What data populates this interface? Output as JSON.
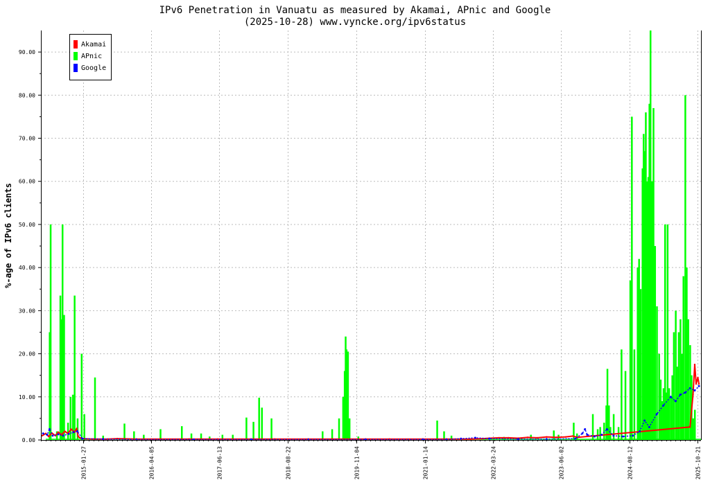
{
  "chart_data": {
    "type": "line",
    "title": "IPv6 Penetration in Vanuatu as measured by Akamai, APnic and Google",
    "subtitle": "(2025-10-28) www.vyncke.org/ipv6status",
    "ylabel": "%-age of IPv6 clients",
    "xlabel": "",
    "ylim": [
      0,
      95
    ],
    "xlim": [
      "2014-05-01",
      "2025-11-10"
    ],
    "yticks": [
      "0.00",
      "10.00",
      "20.00",
      "30.00",
      "40.00",
      "50.00",
      "60.00",
      "70.00",
      "80.00",
      "90.00"
    ],
    "xticks": [
      "2015-01-27",
      "2016-04-05",
      "2017-06-13",
      "2018-08-22",
      "2019-11-04",
      "2021-01-14",
      "2022-03-24",
      "2023-06-02",
      "2024-08-12",
      "2025-10-21"
    ],
    "grid": true,
    "legend_position": "top-left",
    "series": [
      {
        "name": "Akamai",
        "color": "#ff0000",
        "style": "line",
        "points": [
          [
            "2014-05-10",
            1.0
          ],
          [
            "2014-06-01",
            1.5
          ],
          [
            "2014-06-20",
            0.8
          ],
          [
            "2014-07-10",
            1.6
          ],
          [
            "2014-08-01",
            1.0
          ],
          [
            "2014-08-20",
            1.8
          ],
          [
            "2014-09-10",
            1.2
          ],
          [
            "2014-10-01",
            2.0
          ],
          [
            "2014-10-20",
            1.5
          ],
          [
            "2014-11-10",
            2.5
          ],
          [
            "2014-12-01",
            1.8
          ],
          [
            "2014-12-15",
            2.6
          ],
          [
            "2014-12-25",
            0.8
          ],
          [
            "2015-01-05",
            0.5
          ],
          [
            "2015-01-20",
            0.3
          ],
          [
            "2015-04-01",
            0.2
          ],
          [
            "2015-07-01",
            0.2
          ],
          [
            "2015-09-01",
            0.3
          ],
          [
            "2016-01-01",
            0.2
          ],
          [
            "2016-06-01",
            0.2
          ],
          [
            "2016-12-01",
            0.2
          ],
          [
            "2017-06-01",
            0.2
          ],
          [
            "2018-01-01",
            0.2
          ],
          [
            "2018-06-01",
            0.2
          ],
          [
            "2019-01-01",
            0.2
          ],
          [
            "2019-06-01",
            0.2
          ],
          [
            "2020-01-01",
            0.2
          ],
          [
            "2020-06-01",
            0.2
          ],
          [
            "2021-01-01",
            0.2
          ],
          [
            "2021-06-01",
            0.2
          ],
          [
            "2021-11-01",
            0.2
          ],
          [
            "2022-01-15",
            0.3
          ],
          [
            "2022-03-01",
            0.4
          ],
          [
            "2022-05-01",
            0.5
          ],
          [
            "2022-07-01",
            0.5
          ],
          [
            "2022-09-01",
            0.4
          ],
          [
            "2022-11-01",
            0.6
          ],
          [
            "2023-01-01",
            0.5
          ],
          [
            "2023-03-01",
            0.7
          ],
          [
            "2023-05-01",
            0.6
          ],
          [
            "2023-07-01",
            0.7
          ],
          [
            "2023-08-15",
            0.9
          ],
          [
            "2023-09-15",
            0.6
          ],
          [
            "2025-09-01",
            3.0
          ],
          [
            "2025-09-20",
            10.5
          ],
          [
            "2025-10-01",
            17.5
          ],
          [
            "2025-10-10",
            13.0
          ],
          [
            "2025-10-21",
            14.5
          ],
          [
            "2025-10-28",
            13.0
          ]
        ]
      },
      {
        "name": "APnic",
        "color": "#00ff00",
        "style": "spikes",
        "points": [
          [
            "2014-06-25",
            25
          ],
          [
            "2014-07-01",
            50
          ],
          [
            "2014-08-10",
            2
          ],
          [
            "2014-09-01",
            33.5
          ],
          [
            "2014-09-08",
            28
          ],
          [
            "2014-09-15",
            50
          ],
          [
            "2014-09-25",
            29
          ],
          [
            "2014-10-20",
            4
          ],
          [
            "2014-11-05",
            10
          ],
          [
            "2014-11-20",
            10.5
          ],
          [
            "2014-12-01",
            33.5
          ],
          [
            "2014-12-20",
            5
          ],
          [
            "2015-01-15",
            20
          ],
          [
            "2015-02-01",
            6
          ],
          [
            "2015-04-10",
            14.5
          ],
          [
            "2015-06-01",
            1
          ],
          [
            "2015-10-15",
            3.8
          ],
          [
            "2015-12-15",
            2
          ],
          [
            "2016-02-15",
            1.2
          ],
          [
            "2016-06-01",
            2.5
          ],
          [
            "2016-10-15",
            3.2
          ],
          [
            "2016-12-15",
            1.5
          ],
          [
            "2017-02-15",
            1.5
          ],
          [
            "2017-04-10",
            0.8
          ],
          [
            "2017-07-01",
            1.2
          ],
          [
            "2017-09-05",
            1.2
          ],
          [
            "2017-12-01",
            5.2
          ],
          [
            "2018-01-15",
            4.2
          ],
          [
            "2018-02-20",
            9.8
          ],
          [
            "2018-03-10",
            7.5
          ],
          [
            "2018-05-10",
            5
          ],
          [
            "2019-04-01",
            2
          ],
          [
            "2019-06-01",
            2.5
          ],
          [
            "2019-07-15",
            5
          ],
          [
            "2019-08-10",
            10
          ],
          [
            "2019-08-20",
            16
          ],
          [
            "2019-08-26",
            24
          ],
          [
            "2019-09-01",
            21
          ],
          [
            "2019-09-10",
            20.5
          ],
          [
            "2019-09-20",
            5
          ],
          [
            "2019-11-15",
            0.8
          ],
          [
            "2021-04-01",
            4.5
          ],
          [
            "2021-05-15",
            2
          ],
          [
            "2021-07-01",
            1
          ],
          [
            "2022-06-01",
            0.7
          ],
          [
            "2022-11-20",
            1.2
          ],
          [
            "2023-04-15",
            2.2
          ],
          [
            "2023-05-15",
            1.2
          ],
          [
            "2023-08-20",
            4
          ],
          [
            "2023-09-10",
            1.5
          ],
          [
            "2023-12-20",
            6
          ],
          [
            "2024-01-20",
            2.5
          ],
          [
            "2024-02-05",
            3
          ],
          [
            "2024-03-01",
            4
          ],
          [
            "2024-03-15",
            8
          ],
          [
            "2024-03-22",
            16.5
          ],
          [
            "2024-04-01",
            8
          ],
          [
            "2024-04-10",
            3
          ],
          [
            "2024-05-01",
            6
          ],
          [
            "2024-06-01",
            3
          ],
          [
            "2024-06-20",
            21
          ],
          [
            "2024-07-15",
            16
          ],
          [
            "2024-08-15",
            37
          ],
          [
            "2024-08-25",
            75
          ],
          [
            "2024-09-10",
            21
          ],
          [
            "2024-10-01",
            40
          ],
          [
            "2024-10-10",
            42
          ],
          [
            "2024-10-20",
            35
          ],
          [
            "2024-11-01",
            63
          ],
          [
            "2024-11-08",
            71
          ],
          [
            "2024-11-15",
            67
          ],
          [
            "2024-11-22",
            76
          ],
          [
            "2024-12-01",
            60
          ],
          [
            "2024-12-08",
            61
          ],
          [
            "2024-12-15",
            78
          ],
          [
            "2024-12-22",
            95
          ],
          [
            "2025-01-01",
            60
          ],
          [
            "2025-01-05",
            50
          ],
          [
            "2025-01-10",
            77
          ],
          [
            "2025-01-20",
            45
          ],
          [
            "2025-02-01",
            31
          ],
          [
            "2025-02-15",
            20
          ],
          [
            "2025-02-25",
            14
          ],
          [
            "2025-03-05",
            9
          ],
          [
            "2025-03-15",
            12
          ],
          [
            "2025-03-25",
            50
          ],
          [
            "2025-04-01",
            11
          ],
          [
            "2025-04-10",
            50
          ],
          [
            "2025-04-20",
            12
          ],
          [
            "2025-05-01",
            10
          ],
          [
            "2025-05-10",
            15
          ],
          [
            "2025-05-20",
            25
          ],
          [
            "2025-06-01",
            30
          ],
          [
            "2025-06-10",
            17
          ],
          [
            "2025-06-20",
            25
          ],
          [
            "2025-07-01",
            28
          ],
          [
            "2025-07-10",
            20
          ],
          [
            "2025-07-20",
            38
          ],
          [
            "2025-08-01",
            80
          ],
          [
            "2025-08-10",
            40
          ],
          [
            "2025-08-20",
            28
          ],
          [
            "2025-09-01",
            22
          ],
          [
            "2025-09-10",
            15
          ],
          [
            "2025-09-20",
            5
          ],
          [
            "2025-10-01",
            7
          ]
        ]
      },
      {
        "name": "Google",
        "color": "#0000ff",
        "style": "dots",
        "points": [
          [
            "2014-05-15",
            1.5
          ],
          [
            "2014-06-10",
            1.2
          ],
          [
            "2014-06-25",
            2.5
          ],
          [
            "2014-07-15",
            1.0
          ],
          [
            "2014-08-20",
            1.3
          ],
          [
            "2014-09-20",
            1.0
          ],
          [
            "2014-10-25",
            1.4
          ],
          [
            "2014-11-25",
            1.8
          ],
          [
            "2014-12-20",
            2.0
          ],
          [
            "2015-01-20",
            0.3
          ],
          [
            "2015-06-01",
            0.2
          ],
          [
            "2016-01-01",
            0.1
          ],
          [
            "2017-01-01",
            0.1
          ],
          [
            "2018-01-01",
            0.1
          ],
          [
            "2019-01-01",
            0.1
          ],
          [
            "2020-01-01",
            0.1
          ],
          [
            "2021-01-01",
            0.1
          ],
          [
            "2021-06-01",
            0.1
          ],
          [
            "2021-09-01",
            0.3
          ],
          [
            "2021-12-01",
            0.5
          ],
          [
            "2022-03-01",
            0.3
          ],
          [
            "2022-09-01",
            0.2
          ],
          [
            "2023-03-01",
            0.2
          ],
          [
            "2023-09-01",
            0.3
          ],
          [
            "2023-10-15",
            1.5
          ],
          [
            "2023-11-01",
            2.5
          ],
          [
            "2023-11-15",
            1.2
          ],
          [
            "2024-01-01",
            0.8
          ],
          [
            "2024-02-15",
            1.2
          ],
          [
            "2024-03-20",
            2.5
          ],
          [
            "2024-05-01",
            1.0
          ],
          [
            "2024-07-01",
            0.8
          ],
          [
            "2024-09-01",
            1.0
          ],
          [
            "2024-10-15",
            2.0
          ],
          [
            "2024-11-15",
            4.5
          ],
          [
            "2024-12-15",
            3.0
          ],
          [
            "2025-02-01",
            6.0
          ],
          [
            "2025-03-15",
            8.0
          ],
          [
            "2025-05-01",
            10.0
          ],
          [
            "2025-06-01",
            9.0
          ],
          [
            "2025-07-01",
            10.5
          ],
          [
            "2025-08-01",
            11.0
          ],
          [
            "2025-09-01",
            12.0
          ],
          [
            "2025-10-01",
            11.5
          ],
          [
            "2025-10-28",
            12.5
          ]
        ]
      }
    ]
  }
}
